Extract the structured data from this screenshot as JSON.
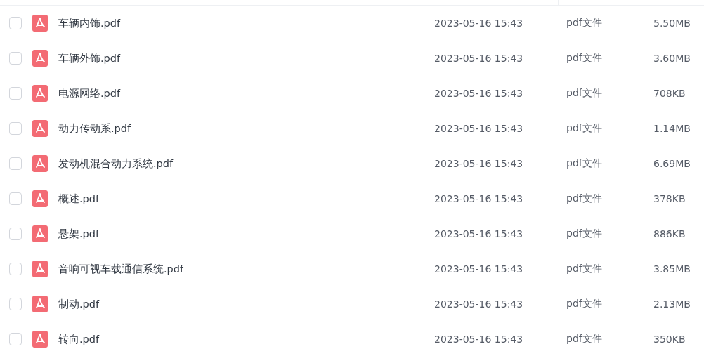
{
  "files": [
    {
      "name": "车辆内饰.pdf",
      "modified": "2023-05-16 15:43",
      "type": "pdf文件",
      "size": "5.50MB",
      "checked": false
    },
    {
      "name": "车辆外饰.pdf",
      "modified": "2023-05-16 15:43",
      "type": "pdf文件",
      "size": "3.60MB",
      "checked": false
    },
    {
      "name": "电源网络.pdf",
      "modified": "2023-05-16 15:43",
      "type": "pdf文件",
      "size": "708KB",
      "checked": false
    },
    {
      "name": "动力传动系.pdf",
      "modified": "2023-05-16 15:43",
      "type": "pdf文件",
      "size": "1.14MB",
      "checked": false
    },
    {
      "name": "发动机混合动力系统.pdf",
      "modified": "2023-05-16 15:43",
      "type": "pdf文件",
      "size": "6.69MB",
      "checked": false
    },
    {
      "name": "概述.pdf",
      "modified": "2023-05-16 15:43",
      "type": "pdf文件",
      "size": "378KB",
      "checked": false
    },
    {
      "name": "悬架.pdf",
      "modified": "2023-05-16 15:43",
      "type": "pdf文件",
      "size": "886KB",
      "checked": false
    },
    {
      "name": "音响可视车载通信系统.pdf",
      "modified": "2023-05-16 15:43",
      "type": "pdf文件",
      "size": "3.85MB",
      "checked": false
    },
    {
      "name": "制动.pdf",
      "modified": "2023-05-16 15:43",
      "type": "pdf文件",
      "size": "2.13MB",
      "checked": false
    },
    {
      "name": "转向.pdf",
      "modified": "2023-05-16 15:43",
      "type": "pdf文件",
      "size": "350KB",
      "checked": false
    }
  ]
}
